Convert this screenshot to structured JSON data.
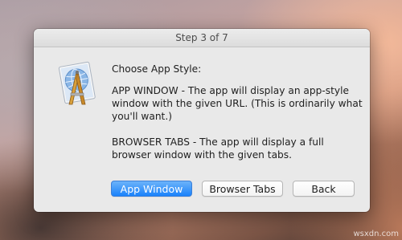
{
  "dialog": {
    "title": "Step 3 of 7",
    "heading": "Choose App Style:",
    "app_window_text": "APP WINDOW - The app will display an app-style window with the given URL. (This is ordinarily what you'll want.)",
    "browser_tabs_text": "BROWSER TABS - The app will display a full browser window with the given tabs.",
    "icon": "applescript-app-icon"
  },
  "buttons": {
    "app_window": "App Window",
    "browser_tabs": "Browser Tabs",
    "back": "Back"
  },
  "colors": {
    "primary_button": "#1a82fb"
  },
  "watermark": "wsxdn.com"
}
